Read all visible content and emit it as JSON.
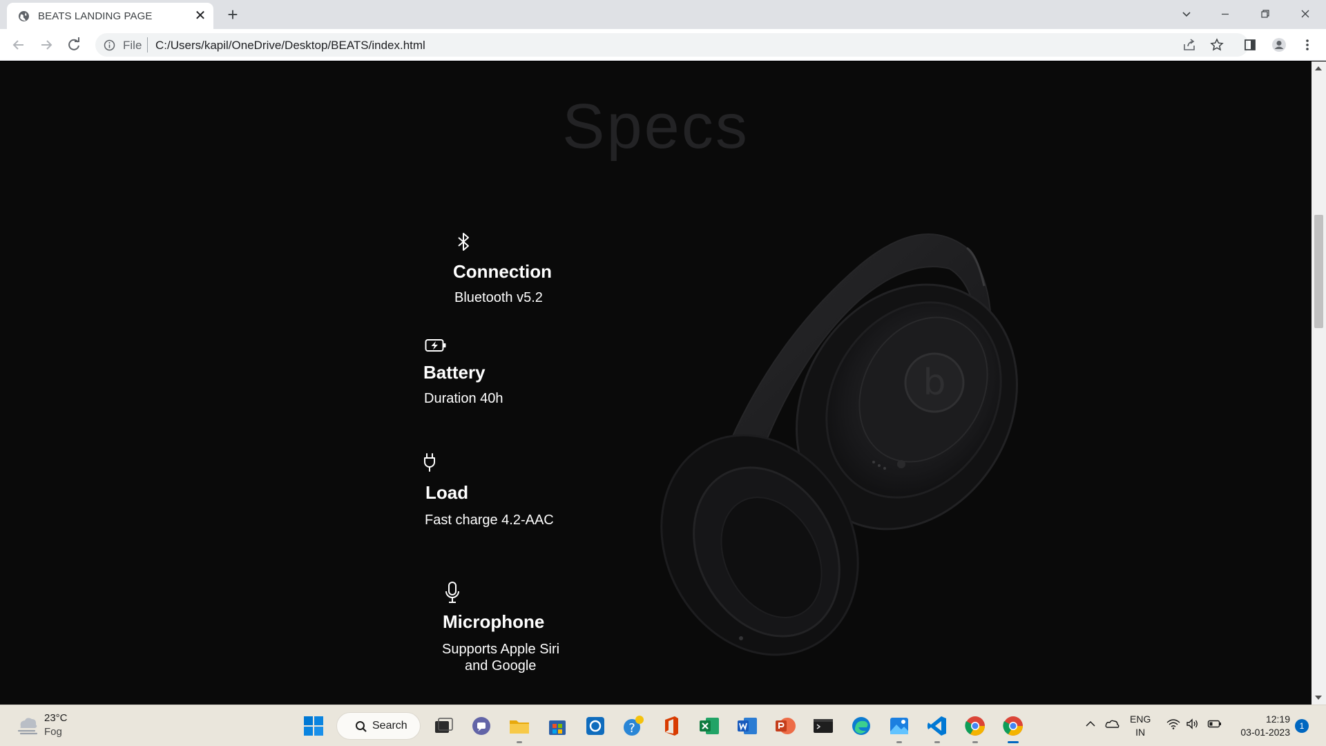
{
  "browser": {
    "tab_title": "BEATS LANDING PAGE",
    "tab_close_glyph": "✕",
    "new_tab_glyph": "+",
    "omnibox_scheme": "File",
    "omnibox_url": "C:/Users/kapil/OneDrive/Desktop/BEATS/index.html"
  },
  "page": {
    "heading": "Specs",
    "specs": [
      {
        "icon": "bluetooth-icon",
        "name": "Connection",
        "value": "Bluetooth v5.2"
      },
      {
        "icon": "battery-charging-icon",
        "name": "Battery",
        "value": "Duration 40h"
      },
      {
        "icon": "plug-icon",
        "name": "Load",
        "value": "Fast charge 4.2-AAC"
      },
      {
        "icon": "microphone-icon",
        "name": "Microphone",
        "value_line1": "Supports Apple Siri",
        "value_line2": "and Google"
      }
    ],
    "product_image": "beats-headphones-black"
  },
  "taskbar": {
    "weather_temp": "23°C",
    "weather_condition": "Fog",
    "search_label": "Search",
    "lang_line1": "ENG",
    "lang_line2": "IN",
    "time": "12:19",
    "date": "03-01-2023",
    "notification_count": "1",
    "apps": [
      "start",
      "search",
      "task-view",
      "teams-chat",
      "file-explorer",
      "microsoft-store",
      "onenote",
      "tips",
      "office",
      "excel",
      "word",
      "powerpoint",
      "terminal",
      "edge",
      "photos",
      "vscode",
      "chrome",
      "chrome-active"
    ]
  },
  "colors": {
    "page_bg": "#0a0a0a",
    "heading": "#232325",
    "accent_taskbar": "#0067c0"
  }
}
